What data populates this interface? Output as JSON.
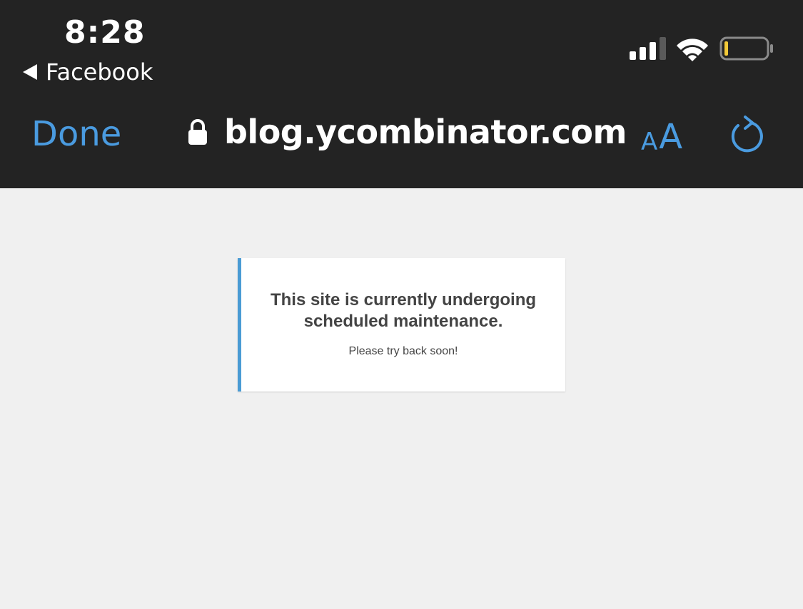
{
  "status_bar": {
    "time": "8:28",
    "back_app_label": "Facebook",
    "signal_icon": "cellular-signal-icon",
    "wifi_icon": "wifi-icon",
    "battery_icon": "battery-low-icon"
  },
  "browser_bar": {
    "done_label": "Done",
    "url": "blog.ycombinator.com",
    "lock_icon": "lock-icon",
    "text_size_small": "A",
    "text_size_large": "A",
    "reload_icon": "reload-icon"
  },
  "page": {
    "title": "This site is currently undergoing scheduled maintenance.",
    "subtitle": "Please try back soon!"
  },
  "colors": {
    "topbar": "#232323",
    "accent": "#4a9be0",
    "page_bg": "#f0f0f0",
    "card_border": "#4a9bd4",
    "battery_level": "#f3c938"
  }
}
